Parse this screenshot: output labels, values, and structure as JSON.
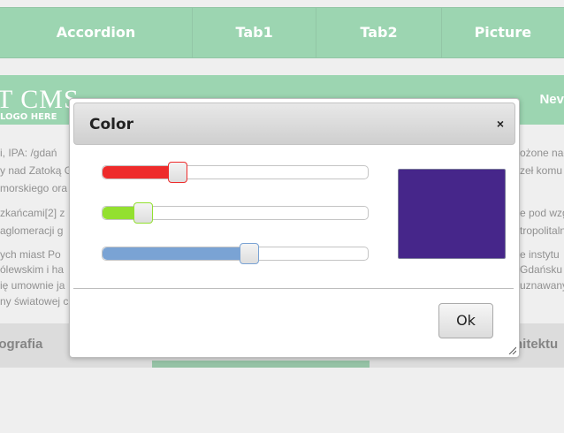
{
  "topnav": {
    "tabs": [
      "Accordion",
      "Tab1",
      "Tab2",
      "Picture"
    ]
  },
  "header": {
    "logo_text": "T CMS",
    "logo_sub": "LOGO HERE",
    "right_label": "Nev"
  },
  "content": {
    "lines": [
      "i, IPA: /gdań",
      "y nad Zatoką G",
      "morskiego ora",
      "zkańcami[2] z",
      "aglomeracji g",
      "ych miast Po",
      "ólewskim i ha",
      "ię umownie ja",
      "ny światowej c"
    ],
    "right_lines": [
      "ożone nad",
      "zeł komu",
      "e pod wzg",
      "tropolitaln",
      "e instytu",
      "Gdańsku",
      "uznawany"
    ]
  },
  "bottom_tabs": {
    "left": "eografia",
    "right": "hitektu"
  },
  "dialog": {
    "title": "Color",
    "close_glyph": "×",
    "ok_label": "Ok",
    "sliders": [
      {
        "name": "red",
        "value_fraction": 0.28,
        "color": "#ee2b2b"
      },
      {
        "name": "green",
        "value_fraction": 0.15,
        "color": "#93e030"
      },
      {
        "name": "blue",
        "value_fraction": 0.55,
        "color": "#7aa3d4"
      }
    ],
    "swatch_color": "#46268a"
  },
  "colors": {
    "accent": "#68bf87",
    "accent_dark": "#5aa877"
  }
}
